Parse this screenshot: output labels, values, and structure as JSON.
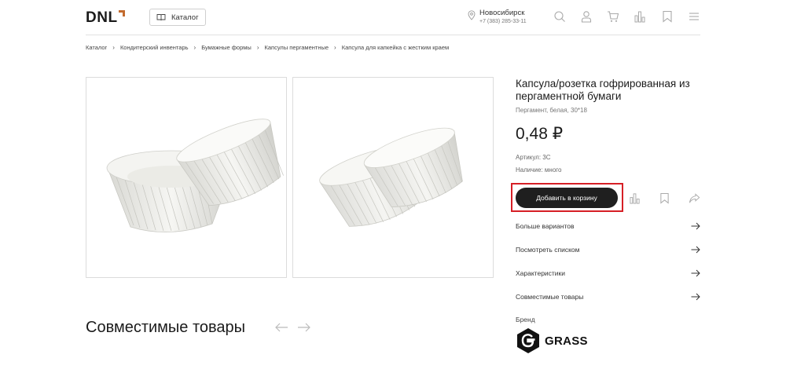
{
  "header": {
    "logo_text": "DNL",
    "catalog_label": "Каталог",
    "city": "Новосибирск",
    "phone": "+7 (383) 285-33-11",
    "icons": [
      "search-icon",
      "user-icon",
      "cart-icon",
      "compare-icon",
      "bookmark-icon",
      "menu-icon"
    ]
  },
  "breadcrumb": {
    "items": [
      "Каталог",
      "Кондитерский инвентарь",
      "Бумажные формы",
      "Капсулы пергаментные",
      "Капсула для капкейка с жестким краем"
    ]
  },
  "product": {
    "title": "Капсула/розетка гофрированная из пергаментной бумаги",
    "subtitle": "Пергамент, белая, 30*18",
    "price": "0,48 ₽",
    "article": "Артикул: 3С",
    "stock": "Наличие: много",
    "add_to_cart": "Добавить в корзину"
  },
  "links": [
    "Больше вариантов",
    "Посмотреть списком",
    "Характеристики",
    "Совместимые товары"
  ],
  "brand": {
    "label": "Бренд",
    "name": "GRASS"
  },
  "compatible": {
    "title": "Совместимые товары"
  },
  "colors": {
    "accent_logo": "#c36b2e",
    "button_bg": "#1f1f1f",
    "highlight": "#d61f26"
  }
}
